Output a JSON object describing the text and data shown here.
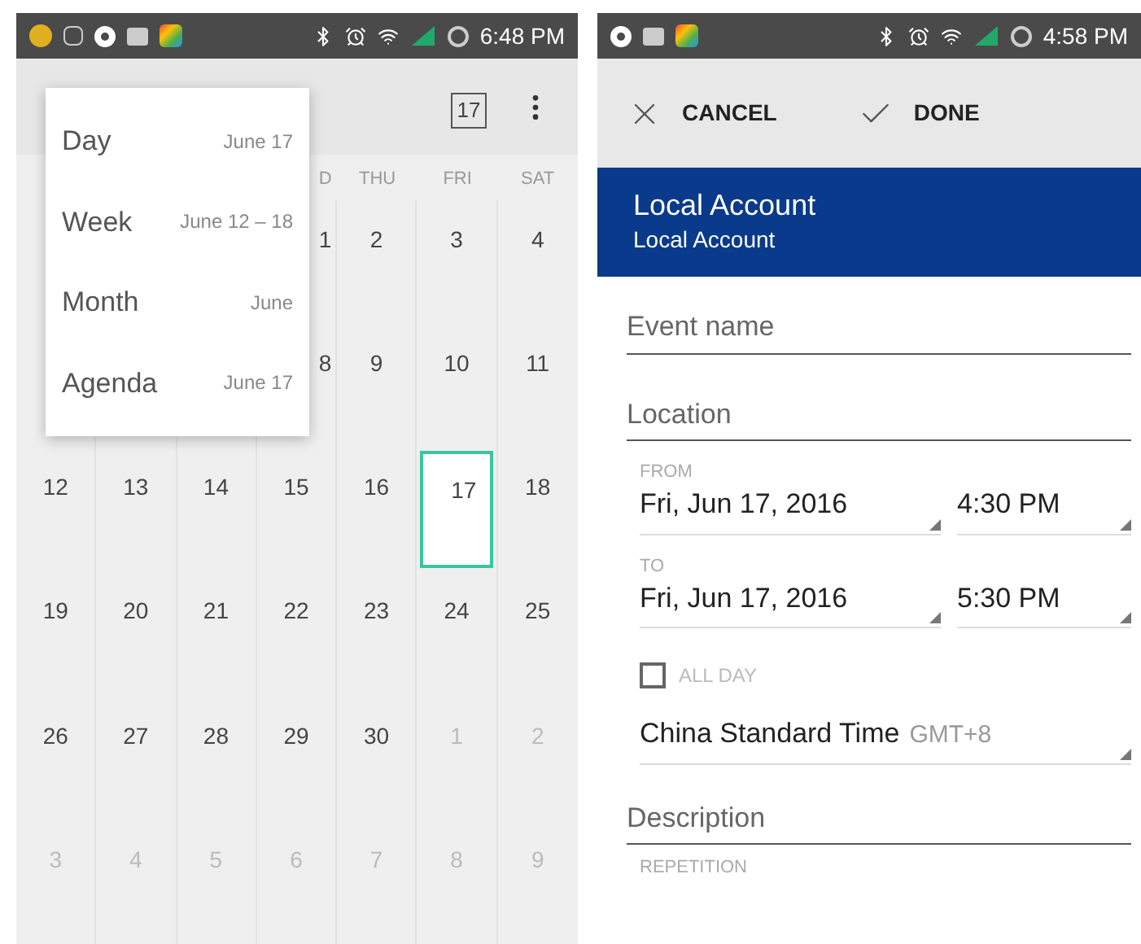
{
  "calendar_screen": {
    "status_bar": {
      "time": "6:48 PM"
    },
    "toolbar": {
      "today_badge": "17"
    },
    "view_menu": [
      {
        "label": "Day",
        "range": "June 17",
        "selected": false
      },
      {
        "label": "Week",
        "range": "June 12 – 18",
        "selected": false
      },
      {
        "label": "Month",
        "range": "June",
        "selected": false
      },
      {
        "label": "Agenda",
        "range": "June 17",
        "selected": false
      }
    ],
    "weekday_headers": [
      "D",
      "THU",
      "FRI",
      "SAT"
    ],
    "weeks": [
      [
        {
          "day": "1",
          "other_month": false,
          "today": false
        },
        {
          "day": "2",
          "other_month": false,
          "today": false
        },
        {
          "day": "3",
          "other_month": false,
          "today": false
        },
        {
          "day": "4",
          "other_month": false,
          "today": false
        }
      ],
      [
        {
          "day": "8",
          "other_month": false,
          "today": false
        },
        {
          "day": "9",
          "other_month": false,
          "today": false
        },
        {
          "day": "10",
          "other_month": false,
          "today": false
        },
        {
          "day": "11",
          "other_month": false,
          "today": false
        }
      ],
      [
        {
          "day": "12",
          "other_month": false,
          "today": false
        },
        {
          "day": "13",
          "other_month": false,
          "today": false
        },
        {
          "day": "14",
          "other_month": false,
          "today": false
        },
        {
          "day": "15",
          "other_month": false,
          "today": false
        },
        {
          "day": "16",
          "other_month": false,
          "today": false
        },
        {
          "day": "17",
          "other_month": false,
          "today": true
        },
        {
          "day": "18",
          "other_month": false,
          "today": false
        }
      ],
      [
        {
          "day": "19",
          "other_month": false,
          "today": false
        },
        {
          "day": "20",
          "other_month": false,
          "today": false
        },
        {
          "day": "21",
          "other_month": false,
          "today": false
        },
        {
          "day": "22",
          "other_month": false,
          "today": false
        },
        {
          "day": "23",
          "other_month": false,
          "today": false
        },
        {
          "day": "24",
          "other_month": false,
          "today": false
        },
        {
          "day": "25",
          "other_month": false,
          "today": false
        }
      ],
      [
        {
          "day": "26",
          "other_month": false,
          "today": false
        },
        {
          "day": "27",
          "other_month": false,
          "today": false
        },
        {
          "day": "28",
          "other_month": false,
          "today": false
        },
        {
          "day": "29",
          "other_month": false,
          "today": false
        },
        {
          "day": "30",
          "other_month": false,
          "today": false
        },
        {
          "day": "1",
          "other_month": true,
          "today": false
        },
        {
          "day": "2",
          "other_month": true,
          "today": false
        }
      ],
      [
        {
          "day": "3",
          "other_month": true,
          "today": false
        },
        {
          "day": "4",
          "other_month": true,
          "today": false
        },
        {
          "day": "5",
          "other_month": true,
          "today": false
        },
        {
          "day": "6",
          "other_month": true,
          "today": false
        },
        {
          "day": "7",
          "other_month": true,
          "today": false
        },
        {
          "day": "8",
          "other_month": true,
          "today": false
        },
        {
          "day": "9",
          "other_month": true,
          "today": false
        }
      ]
    ]
  },
  "event_screen": {
    "status_bar": {
      "time": "4:58 PM"
    },
    "actions": {
      "cancel": "CANCEL",
      "done": "DONE"
    },
    "account": {
      "title": "Local Account",
      "subtitle": "Local Account"
    },
    "event_name": {
      "placeholder": "Event name"
    },
    "location": {
      "placeholder": "Location"
    },
    "from": {
      "label": "FROM",
      "date": "Fri, Jun 17, 2016",
      "time": "4:30 PM"
    },
    "to": {
      "label": "TO",
      "date": "Fri, Jun 17, 2016",
      "time": "5:30 PM"
    },
    "all_day": {
      "label": "ALL DAY",
      "checked": false
    },
    "timezone": {
      "name": "China Standard Time",
      "offset": "GMT+8"
    },
    "description": {
      "placeholder": "Description"
    },
    "repetition": {
      "label": "REPETITION"
    }
  }
}
